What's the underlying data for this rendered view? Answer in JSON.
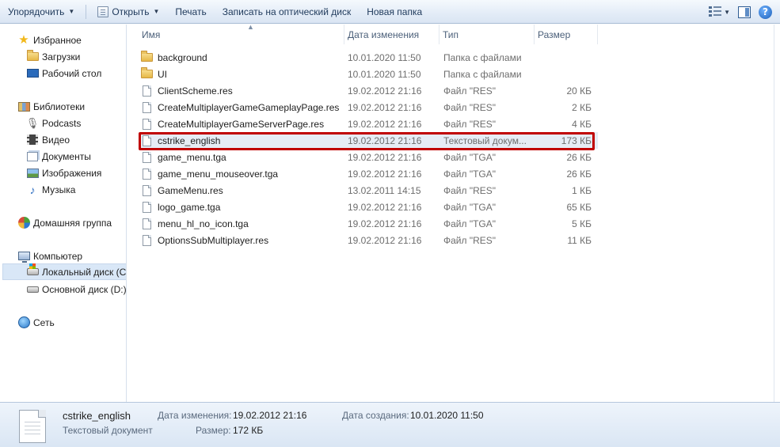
{
  "toolbar": {
    "organize": "Упорядочить",
    "open": "Открыть",
    "print": "Печать",
    "burn": "Записать на оптический диск",
    "new_folder": "Новая папка"
  },
  "nav": {
    "favorites": "Избранное",
    "downloads": "Загрузки",
    "desktop": "Рабочий стол",
    "libraries": "Библиотеки",
    "podcasts": "Podcasts",
    "video": "Видео",
    "documents": "Документы",
    "images": "Изображения",
    "music": "Музыка",
    "homegroup": "Домашняя группа",
    "computer": "Компьютер",
    "local_disk": "Локальный диск (C",
    "main_disk": "Основной диск (D:)",
    "network": "Сеть"
  },
  "columns": {
    "name": "Имя",
    "date": "Дата изменения",
    "type": "Тип",
    "size": "Размер"
  },
  "files": [
    {
      "name": "background",
      "date": "10.01.2020 11:50",
      "type": "Папка с файлами",
      "size": "",
      "kind": "folder"
    },
    {
      "name": "UI",
      "date": "10.01.2020 11:50",
      "type": "Папка с файлами",
      "size": "",
      "kind": "folder"
    },
    {
      "name": "ClientScheme.res",
      "date": "19.02.2012 21:16",
      "type": "Файл \"RES\"",
      "size": "20 КБ",
      "kind": "file"
    },
    {
      "name": "CreateMultiplayerGameGameplayPage.res",
      "date": "19.02.2012 21:16",
      "type": "Файл \"RES\"",
      "size": "2 КБ",
      "kind": "file"
    },
    {
      "name": "CreateMultiplayerGameServerPage.res",
      "date": "19.02.2012 21:16",
      "type": "Файл \"RES\"",
      "size": "4 КБ",
      "kind": "file"
    },
    {
      "name": "cstrike_english",
      "date": "19.02.2012 21:16",
      "type": "Текстовый докум...",
      "size": "173 КБ",
      "kind": "file",
      "selected": true
    },
    {
      "name": "game_menu.tga",
      "date": "19.02.2012 21:16",
      "type": "Файл \"TGA\"",
      "size": "26 КБ",
      "kind": "file"
    },
    {
      "name": "game_menu_mouseover.tga",
      "date": "19.02.2012 21:16",
      "type": "Файл \"TGA\"",
      "size": "26 КБ",
      "kind": "file"
    },
    {
      "name": "GameMenu.res",
      "date": "13.02.2011 14:15",
      "type": "Файл \"RES\"",
      "size": "1 КБ",
      "kind": "file"
    },
    {
      "name": "logo_game.tga",
      "date": "19.02.2012 21:16",
      "type": "Файл \"TGA\"",
      "size": "65 КБ",
      "kind": "file"
    },
    {
      "name": "menu_hl_no_icon.tga",
      "date": "19.02.2012 21:16",
      "type": "Файл \"TGA\"",
      "size": "5 КБ",
      "kind": "file"
    },
    {
      "name": "OptionsSubMultiplayer.res",
      "date": "19.02.2012 21:16",
      "type": "Файл \"RES\"",
      "size": "11 КБ",
      "kind": "file"
    }
  ],
  "details": {
    "filename": "cstrike_english",
    "filetype": "Текстовый документ",
    "modified_label": "Дата изменения:",
    "modified_value": "19.02.2012 21:16",
    "size_label": "Размер:",
    "size_value": "172 КБ",
    "created_label": "Дата создания:",
    "created_value": "10.01.2020 11:50"
  },
  "colors": {
    "highlight_border": "#c00000",
    "selection": "#e6ecf5",
    "toolbar_text": "#1e395b"
  }
}
